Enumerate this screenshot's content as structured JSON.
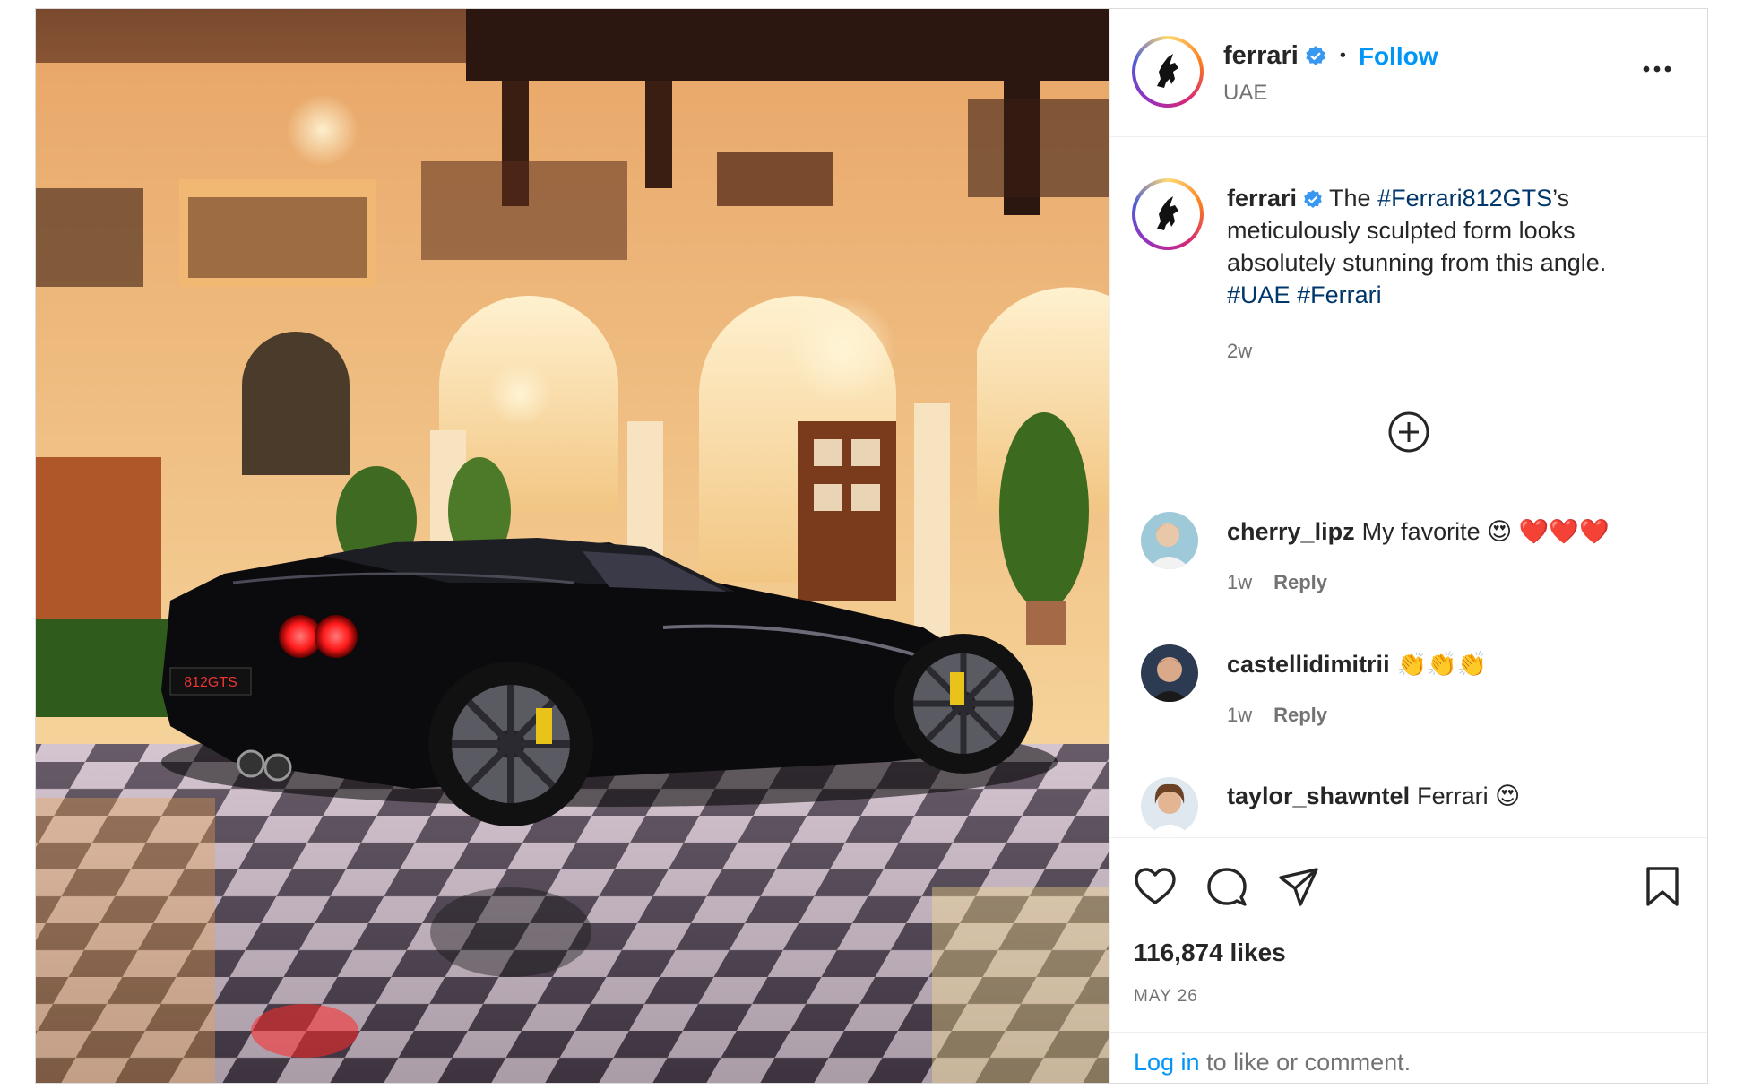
{
  "post": {
    "username": "ferrari",
    "location": "UAE",
    "follow_label": "Follow",
    "separator": "•",
    "more_label": "more-options"
  },
  "caption": {
    "username": "ferrari",
    "text_before": "The ",
    "hashtag_main": "#Ferrari812GTS",
    "text_after": "’s meticulously sculpted form looks absolutely stunning from this angle.",
    "hashtag_2": "#UAE",
    "hashtag_3": "#Ferrari",
    "time": "2w"
  },
  "comments": [
    {
      "username": "cherry_lipz",
      "text": "My favorite 😍 ❤️❤️❤️",
      "time": "1w",
      "reply": "Reply"
    },
    {
      "username": "castellidimitrii",
      "text": "👏👏👏",
      "time": "1w",
      "reply": "Reply"
    },
    {
      "username": "taylor_shawntel",
      "text": "Ferrari 😍",
      "time": "",
      "reply": ""
    }
  ],
  "stats": {
    "likes": "116,874 likes",
    "date": "MAY 26"
  },
  "login": {
    "link": "Log in",
    "rest": " to like or comment."
  },
  "colors": {
    "link_blue": "#0095f6",
    "hashtag_blue": "#00376b",
    "verified_blue": "#3897f0",
    "muted": "#737373"
  },
  "photo": {
    "plate": "812GTS"
  }
}
